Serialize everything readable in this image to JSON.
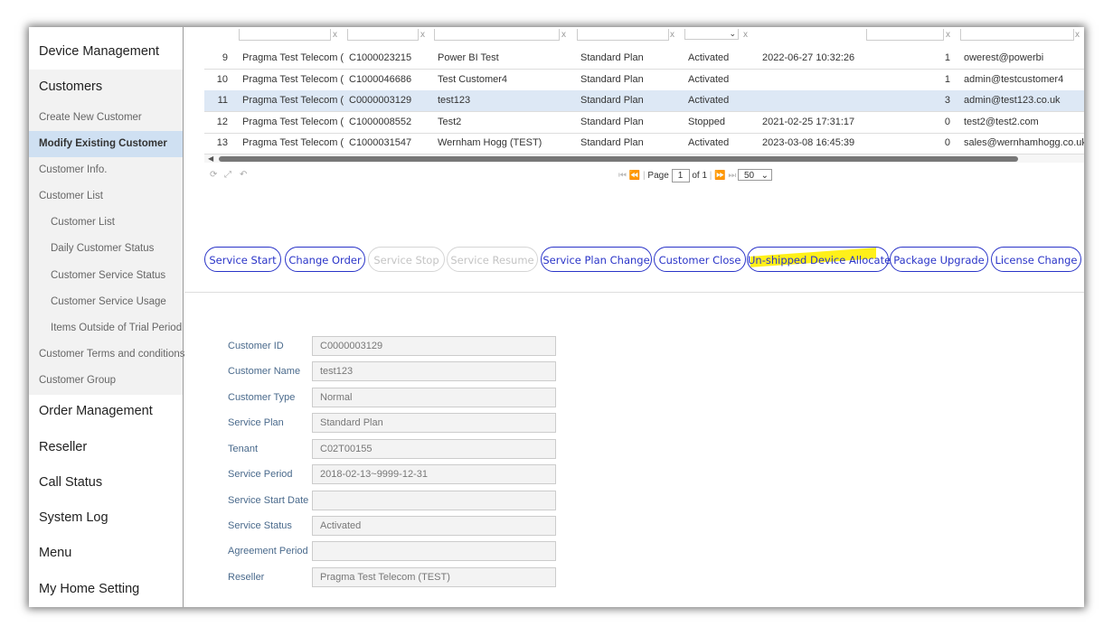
{
  "sidebar": {
    "main_items": [
      {
        "label": "Device Management"
      },
      {
        "label": "Customers"
      },
      {
        "label": "Order Management"
      },
      {
        "label": "Reseller"
      },
      {
        "label": "Call Status"
      },
      {
        "label": "System Log"
      },
      {
        "label": "Menu"
      },
      {
        "label": "My Home Setting"
      }
    ],
    "sub_items": [
      {
        "label": "Create New Customer"
      },
      {
        "label": "Modify Existing Customer",
        "active": true
      },
      {
        "label": "Customer Info."
      },
      {
        "label": "Customer List"
      },
      {
        "label": "Customer List"
      },
      {
        "label": "Daily Customer Status"
      },
      {
        "label": "Customer Service Status"
      },
      {
        "label": "Customer Service Usage"
      },
      {
        "label": "Items Outside of Trial Period"
      },
      {
        "label": "Customer Terms and conditions"
      },
      {
        "label": "Customer Group"
      }
    ]
  },
  "table": {
    "filter_clear_glyph": "x",
    "rows": [
      {
        "no": "9",
        "reseller": "Pragma Test Telecom (TE",
        "id": "C1000023215",
        "name": "Power BI Test",
        "plan": "Standard Plan",
        "status": "Activated",
        "date": "2022-06-27 10:32:26",
        "count": "1",
        "email": "owerest@powerbi"
      },
      {
        "no": "10",
        "reseller": "Pragma Test Telecom (TE",
        "id": "C1000046686",
        "name": "Test Customer4",
        "plan": "Standard Plan",
        "status": "Activated",
        "date": "",
        "count": "1",
        "email": "admin@testcustomer4"
      },
      {
        "no": "11",
        "reseller": "Pragma Test Telecom (TE",
        "id": "C0000003129",
        "name": "test123",
        "plan": "Standard Plan",
        "status": "Activated",
        "date": "",
        "count": "3",
        "email": "admin@test123.co.uk"
      },
      {
        "no": "12",
        "reseller": "Pragma Test Telecom (TE",
        "id": "C1000008552",
        "name": "Test2",
        "plan": "Standard Plan",
        "status": "Stopped",
        "date": "2021-02-25 17:31:17",
        "count": "0",
        "email": "test2@test2.com"
      },
      {
        "no": "13",
        "reseller": "Pragma Test Telecom (TE",
        "id": "C1000031547",
        "name": "Wernham Hogg (TEST)",
        "plan": "Standard Plan",
        "status": "Activated",
        "date": "2023-03-08 16:45:39",
        "count": "0",
        "email": "sales@wernhamhogg.co.uk"
      }
    ],
    "selected_row_index": 2
  },
  "pager": {
    "page_label": "Page",
    "page_value": "1",
    "of_label": "of 1",
    "page_size": "50"
  },
  "actions": [
    {
      "label": "Service Start",
      "enabled": true
    },
    {
      "label": "Change Order",
      "enabled": true
    },
    {
      "label": "Service Stop",
      "enabled": false
    },
    {
      "label": "Service Resume",
      "enabled": false
    },
    {
      "label": "Service Plan Change",
      "enabled": true
    },
    {
      "label": "Customer Close",
      "enabled": true
    },
    {
      "label": "Un-shipped Device Allocate",
      "enabled": true,
      "highlighted": true
    },
    {
      "label": "Package Upgrade",
      "enabled": true
    },
    {
      "label": "License Change",
      "enabled": true
    }
  ],
  "details": [
    {
      "label": "Customer ID",
      "value": "C0000003129"
    },
    {
      "label": "Customer Name",
      "value": "test123"
    },
    {
      "label": "Customer Type",
      "value": "Normal"
    },
    {
      "label": "Service Plan",
      "value": "Standard Plan"
    },
    {
      "label": "Tenant",
      "value": "C02T00155"
    },
    {
      "label": "Service Period",
      "value": "2018-02-13~9999-12-31"
    },
    {
      "label": "Service Start Date",
      "value": ""
    },
    {
      "label": "Service Status",
      "value": "Activated"
    },
    {
      "label": "Agreement Period",
      "value": ""
    },
    {
      "label": "Reseller",
      "value": "Pragma Test Telecom (TEST)"
    }
  ],
  "colors": {
    "accent": "#2a34c8",
    "highlight": "#ffee00",
    "selected_row": "#dde8f5",
    "active_nav": "#cfe0f2"
  }
}
